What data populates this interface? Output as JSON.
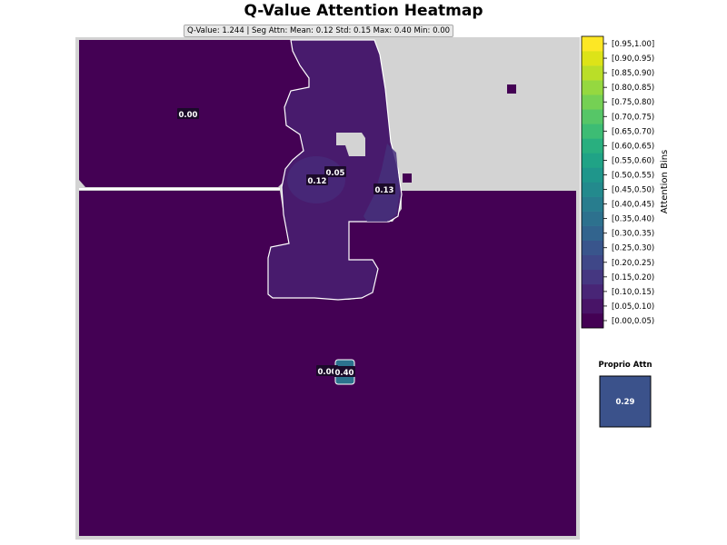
{
  "title": "Q-Value Attention Heatmap",
  "subtitle": "Q-Value: 1.244  |  Seg Attn: Mean: 0.12 Std: 0.15 Max: 0.40 Min: 0.00",
  "chart_data": {
    "type": "heatmap",
    "title": "Q-Value Attention Heatmap",
    "colormap": "viridis",
    "regions": [
      {
        "label": "0.00",
        "value": 0.0,
        "color": "#440154"
      },
      {
        "label": "0.05",
        "value": 0.05,
        "color": "#481b6d"
      },
      {
        "label": "0.12",
        "value": 0.12,
        "color": "#482979"
      },
      {
        "label": "0.13",
        "value": 0.13,
        "color": "#47307b"
      },
      {
        "label": "0.00",
        "value": 0.0,
        "color": "#440154"
      },
      {
        "label": "0.40",
        "value": 0.4,
        "color": "#2c728e"
      }
    ],
    "colorbar": {
      "label": "Attention Bins",
      "range": [
        0,
        1
      ],
      "bins": [
        "[0.00,0.05)",
        "[0.05,0.10)",
        "[0.10,0.15)",
        "[0.15,0.20)",
        "[0.20,0.25)",
        "[0.25,0.30)",
        "[0.30,0.35)",
        "[0.35,0.40)",
        "[0.40,0.45)",
        "[0.45,0.50)",
        "[0.50,0.55)",
        "[0.55,0.60)",
        "[0.60,0.65)",
        "[0.65,0.70)",
        "[0.70,0.75)",
        "[0.75,0.80)",
        "[0.80,0.85)",
        "[0.85,0.90)",
        "[0.90,0.95)",
        "[0.95,1.00]"
      ],
      "colors": [
        "#440154",
        "#481467",
        "#482576",
        "#453781",
        "#3f4788",
        "#39558c",
        "#32648e",
        "#2d718e",
        "#287d8e",
        "#238a8d",
        "#1f968b",
        "#20a386",
        "#29af7f",
        "#3dbc74",
        "#56c667",
        "#75d054",
        "#95d840",
        "#bade28",
        "#dde318",
        "#fde725"
      ]
    },
    "proprio": {
      "title": "Proprio Attn",
      "value": 0.29,
      "label": "0.29",
      "color": "#3b528b"
    }
  }
}
